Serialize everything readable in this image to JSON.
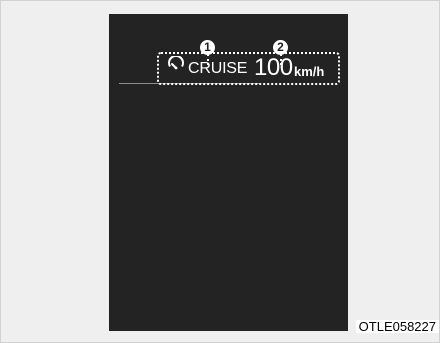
{
  "display": {
    "cruise_label": "CRUISE",
    "speed_value": "100",
    "speed_unit": "km/h",
    "callouts": [
      "1",
      "2"
    ],
    "icon": "cruise-control-speedometer-icon"
  },
  "footer": {
    "image_code": "OTLE058227"
  },
  "colors": {
    "background": "#efefef",
    "screen": "#232323",
    "text": "#ffffff",
    "outline": "#ffffff"
  }
}
